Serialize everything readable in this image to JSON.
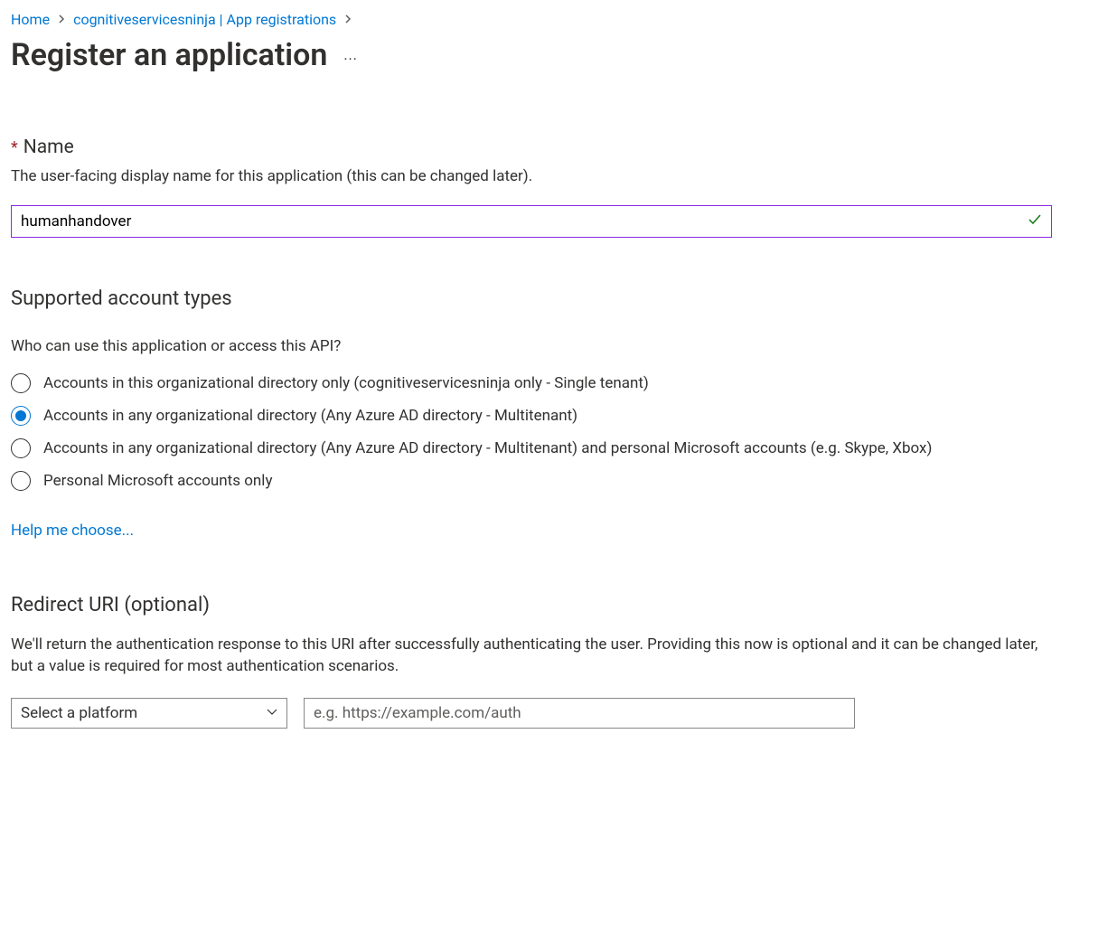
{
  "breadcrumb": {
    "items": [
      {
        "label": "Home"
      },
      {
        "label": "cognitiveservicesninja | App registrations"
      }
    ]
  },
  "header": {
    "title": "Register an application",
    "more": "···"
  },
  "name_section": {
    "label": "Name",
    "description": "The user-facing display name for this application (this can be changed later).",
    "value": "humanhandover"
  },
  "account_types": {
    "heading": "Supported account types",
    "question": "Who can use this application or access this API?",
    "options": [
      {
        "label": "Accounts in this organizational directory only (cognitiveservicesninja only - Single tenant)",
        "selected": false
      },
      {
        "label": "Accounts in any organizational directory (Any Azure AD directory - Multitenant)",
        "selected": true
      },
      {
        "label": "Accounts in any organizational directory (Any Azure AD directory - Multitenant) and personal Microsoft accounts (e.g. Skype, Xbox)",
        "selected": false
      },
      {
        "label": "Personal Microsoft accounts only",
        "selected": false
      }
    ],
    "help_link": "Help me choose..."
  },
  "redirect_uri": {
    "heading": "Redirect URI (optional)",
    "description": "We'll return the authentication response to this URI after successfully authenticating the user. Providing this now is optional and it can be changed later, but a value is required for most authentication scenarios.",
    "platform_placeholder": "Select a platform",
    "uri_placeholder": "e.g. https://example.com/auth"
  }
}
